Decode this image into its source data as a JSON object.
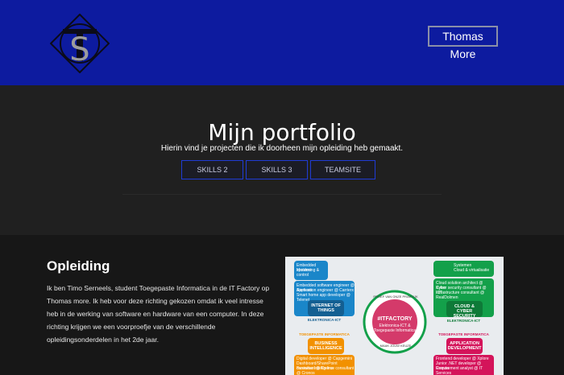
{
  "header": {
    "logo_letters": "TS",
    "brand_button": "Thomas More"
  },
  "hero": {
    "title": "Mijn portfolio",
    "subtitle": "Hierin vind je projecten die ik doorheen mijn opleiding heb gemaakt.",
    "buttons": [
      "SKILLS 2",
      "SKILLS 3",
      "TEAMSITE"
    ]
  },
  "section": {
    "title": "Opleiding",
    "text": "Ik ben Timo Serneels, student Toegepaste Informatica in de IT Factory op Thomas more. Ik heb voor deze richting gekozen omdat ik veel intresse heb in de werking van software en hardware van een computer. In deze richting krijgen we een voorproefje van de verschillende opleidingsonderdelen in het 2de jaar."
  },
  "poster": {
    "center_title": "#ITFACTORY",
    "center_sub1": "Elektronica-ICT &",
    "center_sub2": "Toegepaste Informatica",
    "ring_top": "PROEF VAN ONZE PRAKTIJK",
    "ring_bottom": "MAAK JOUW KEUZE",
    "iot_label": "INTERNET OF THINGS",
    "iot_strip": "ELEKTRONICA-ICT",
    "cyber_label": "CLOUD & CYBER SECURITY",
    "cyber_strip": "ELEKTRONICA-ICT",
    "bi_strip": "TOEGEPASTE INFORMATICA",
    "bi_label": "BUSINESS INTELLIGENCE",
    "app_strip": "TOEGEPASTE INFORMATICA",
    "app_label": "APPLICATION DEVELOPMENT",
    "iot_items": [
      "Embedded systems",
      "Monitoring & control",
      "Smart home with apps",
      "Hardware Interfacing"
    ],
    "iot_jobs": [
      "Embedded software engineer @ Siemens",
      "Application engineer @ Carrierx",
      "Smart home app developer @ Telenet",
      "Alarm & surveillance technician @ Sekuriteit",
      "Software defined radio engineer @ National Instruments"
    ],
    "cyber_items": [
      "Systemen",
      "Cloud & virtualisatie",
      "Netwerken",
      "Infrastructuur"
    ],
    "cyber_jobs": [
      "Cloud solution architect @ Xylos",
      "Cyber security consultant @ ICT",
      "Infrastructure consultant @ RealDolmen",
      "Customer support engineer @ Van Roey",
      "System engineer @ Cegeka"
    ],
    "bi_jobs": [
      "Digital developer @ Capgemini",
      "Dashboard/SharePoint consultant @ Ordina",
      "Business Intelligence consultant @ Cronos",
      "Analytics consultant @ Delaware"
    ],
    "app_jobs": [
      "Frontend developer @ Xplore",
      "Junior .NET developer @ Cronos",
      "Requirement analyst @ IT Services",
      "Agile software developer @ Cegeka",
      "Java analyst developer @ Ordina"
    ]
  }
}
